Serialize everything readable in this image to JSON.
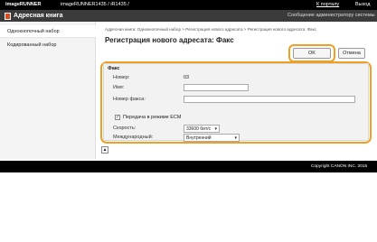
{
  "topbar": {
    "brand": "imageRUNNER",
    "model": "imageRUNNER1435 / iR1435 /",
    "portal_link": "К порталу",
    "logout_link": "Выход"
  },
  "titlebar": {
    "app_title": "Адресная книга",
    "admin_link": "Сообщение администратору системы"
  },
  "sidebar": {
    "items": [
      {
        "label": "Однокнопочный набор"
      },
      {
        "label": "Кодированный набор"
      }
    ]
  },
  "main": {
    "breadcrumb": "Адресная книга: Однокнопочный набор > Регистрация нового адресата > Регистрация нового адресата: Факс",
    "title": "Регистрация нового адресата: Факс",
    "ok_label": "OK",
    "cancel_label": "Отмена",
    "form": {
      "section": "Факс",
      "number_label": "Номер:",
      "number_value": "03",
      "name_label": "Имя:",
      "name_value": "",
      "fax_label": "Номер факса:",
      "fax_value": "",
      "ecm_checked": "✓",
      "ecm_label": "Передача в режиме ECM",
      "speed_label": "Скорость:",
      "speed_value": "33600 бит/с",
      "intl_label": "Международный:",
      "intl_value": "Внутренний"
    },
    "top_icon": "▲"
  },
  "footer": {
    "copyright": "Copyright CANON INC. 2015"
  }
}
